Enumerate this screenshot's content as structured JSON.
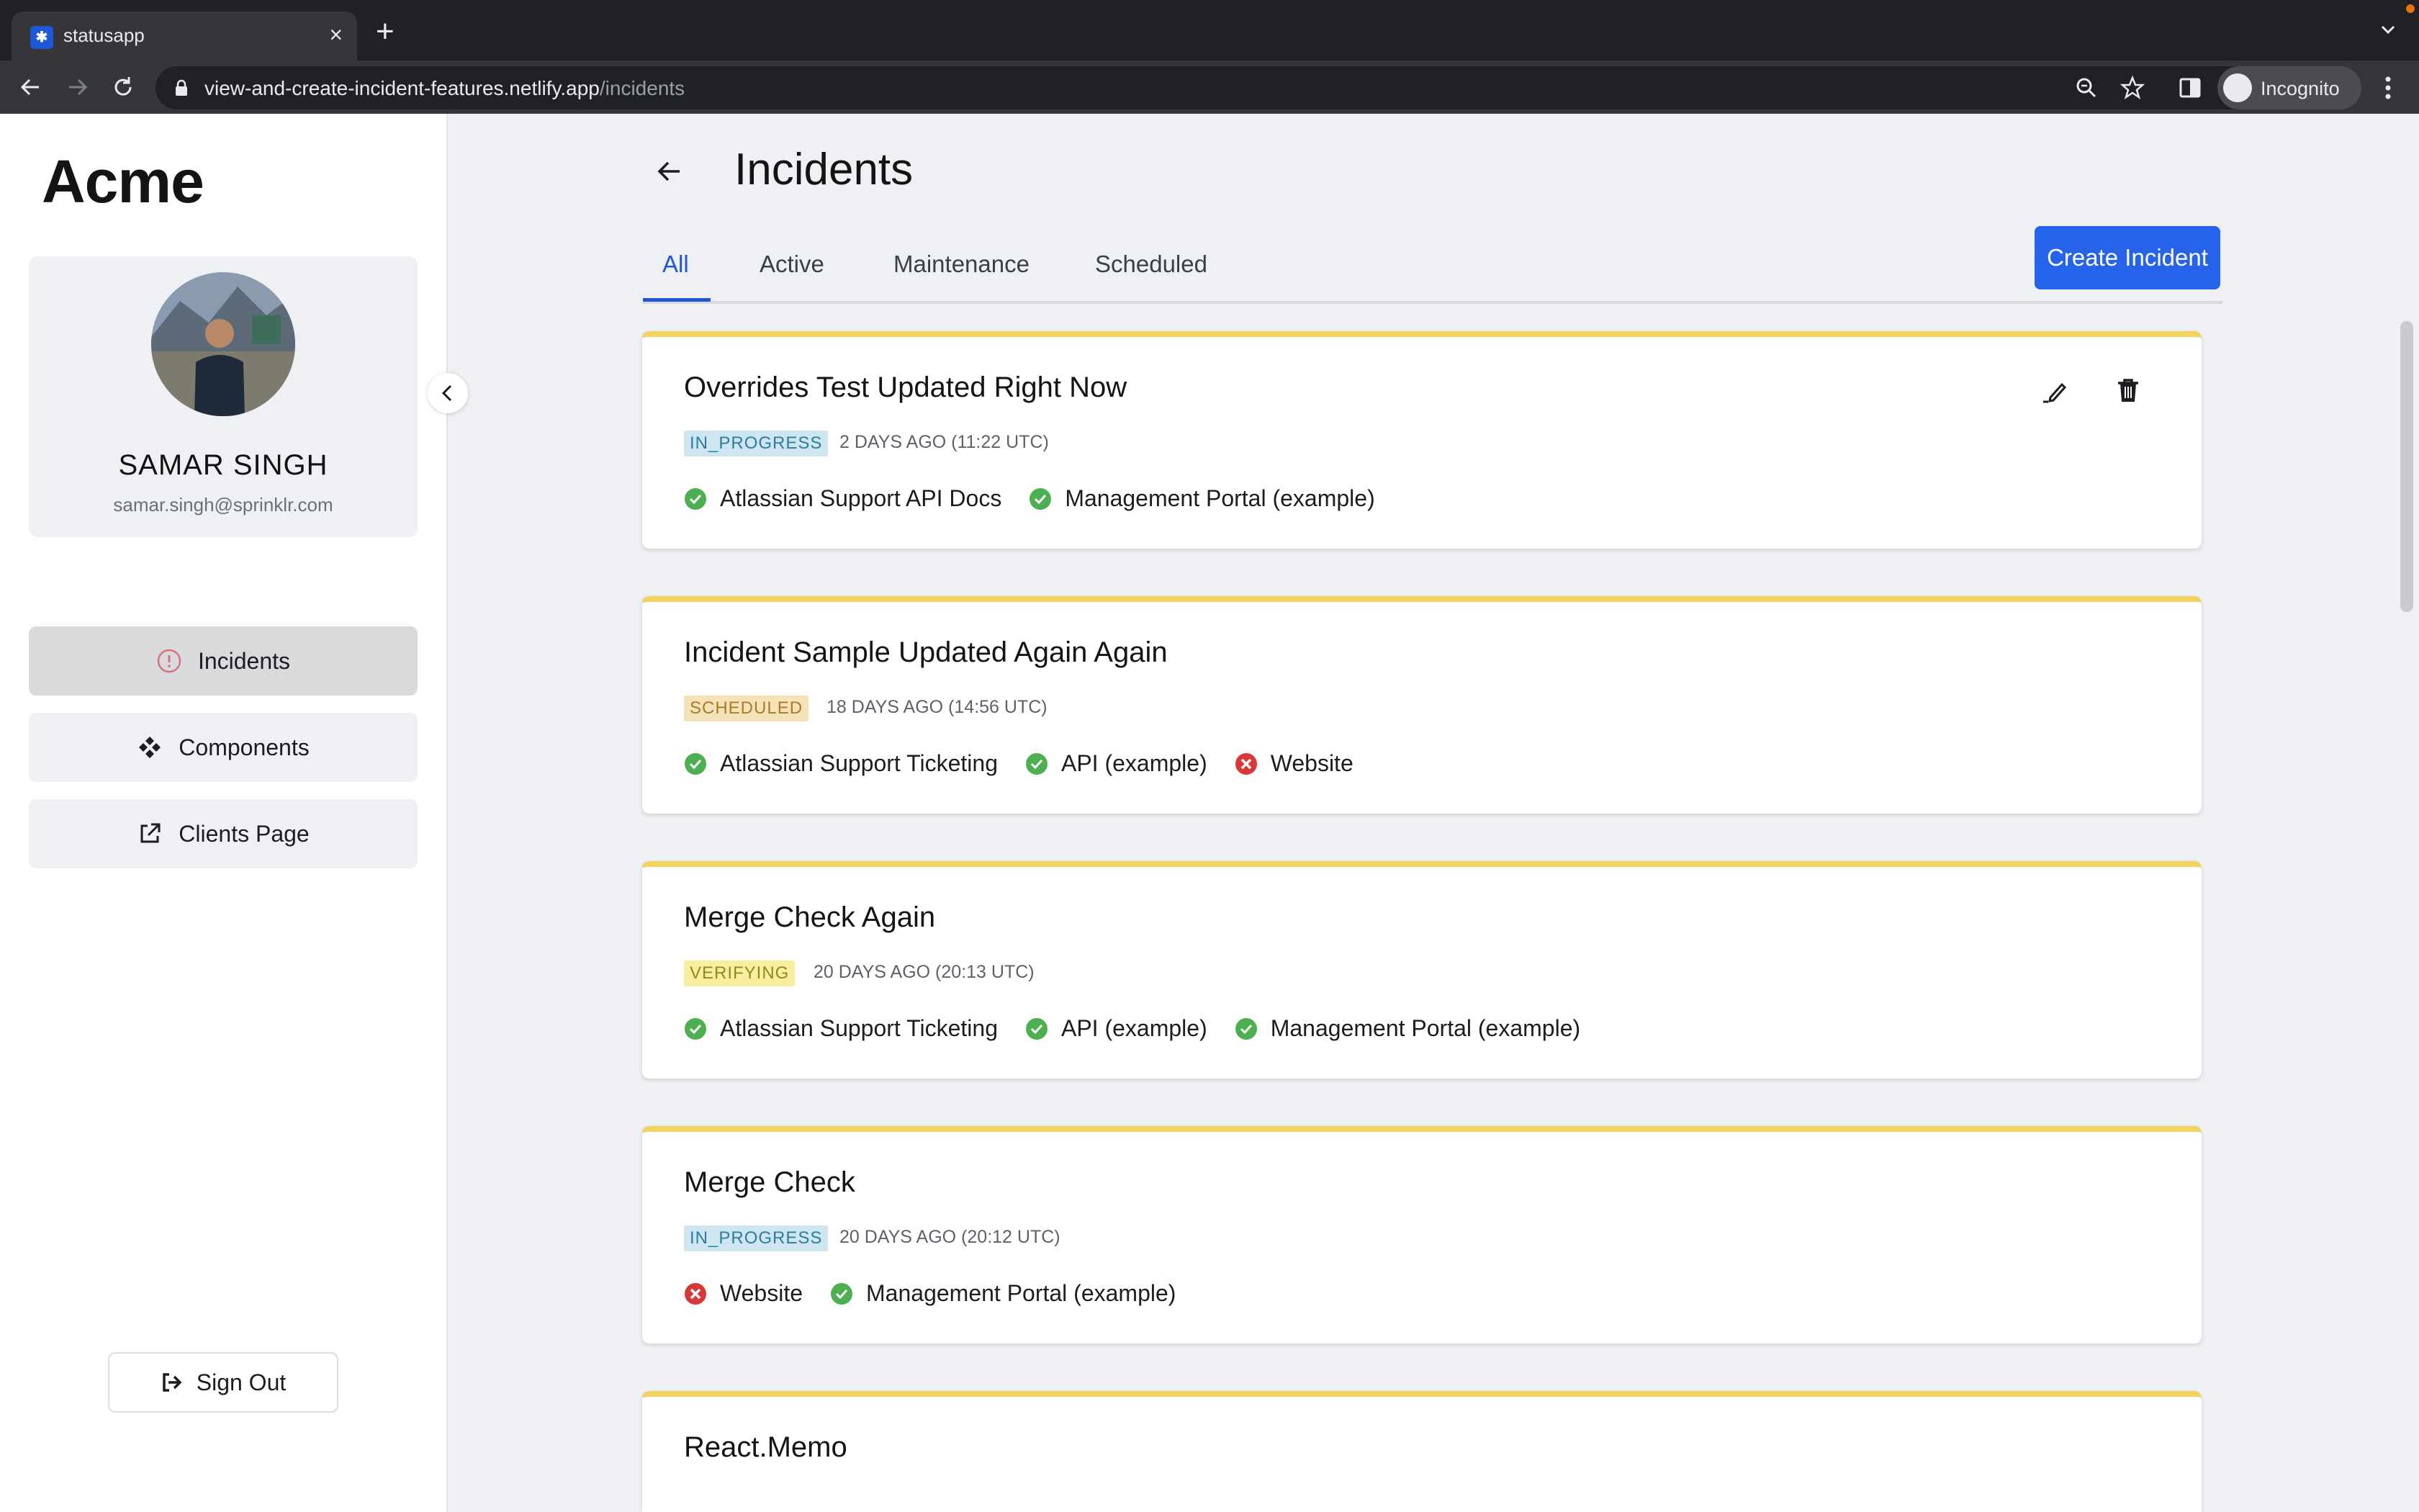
{
  "browser": {
    "tab_title": "statusapp",
    "url_host": "view-and-create-incident-features.netlify.app",
    "url_path": "/incidents",
    "profile_label": "Incognito"
  },
  "sidebar": {
    "brand": "Acme",
    "user": {
      "name": "SAMAR SINGH",
      "email": "samar.singh@sprinklr.com"
    },
    "nav": [
      {
        "label": "Incidents",
        "icon": "alert-circle-icon",
        "active": true
      },
      {
        "label": "Components",
        "icon": "components-icon",
        "active": false
      },
      {
        "label": "Clients Page",
        "icon": "external-link-icon",
        "active": false
      }
    ],
    "signout_label": "Sign Out"
  },
  "main": {
    "title": "Incidents",
    "tabs": [
      {
        "label": "All",
        "active": true
      },
      {
        "label": "Active",
        "active": false
      },
      {
        "label": "Maintenance",
        "active": false
      },
      {
        "label": "Scheduled",
        "active": false
      }
    ],
    "create_label": "Create Incident",
    "incidents": [
      {
        "title": "Overrides Test Updated Right Now",
        "status": "IN_PROGRESS",
        "time": "2 DAYS AGO (11:22 UTC)",
        "components": [
          {
            "name": "Atlassian Support API Docs",
            "state": "ok"
          },
          {
            "name": "Management Portal (example)",
            "state": "ok"
          }
        ]
      },
      {
        "title": "Incident Sample Updated Again Again",
        "status": "SCHEDULED",
        "time": "18 DAYS AGO (14:56 UTC)",
        "components": [
          {
            "name": "Atlassian Support Ticketing",
            "state": "ok"
          },
          {
            "name": "API (example)",
            "state": "ok"
          },
          {
            "name": "Website",
            "state": "error"
          }
        ]
      },
      {
        "title": "Merge Check Again",
        "status": "VERIFYING",
        "time": "20 DAYS AGO (20:13 UTC)",
        "components": [
          {
            "name": "Atlassian Support Ticketing",
            "state": "ok"
          },
          {
            "name": "API (example)",
            "state": "ok"
          },
          {
            "name": "Management Portal (example)",
            "state": "ok"
          }
        ]
      },
      {
        "title": "Merge Check",
        "status": "IN_PROGRESS",
        "time": "20 DAYS AGO (20:12 UTC)",
        "components": [
          {
            "name": "Website",
            "state": "error"
          },
          {
            "name": "Management Portal (example)",
            "state": "ok"
          }
        ]
      },
      {
        "title": "React.Memo",
        "status": "",
        "time": "",
        "components": []
      }
    ]
  },
  "colors": {
    "accent": "#2563eb",
    "card_top_border": "#f1d35e",
    "ok": "#4caf50",
    "error": "#d93838"
  }
}
